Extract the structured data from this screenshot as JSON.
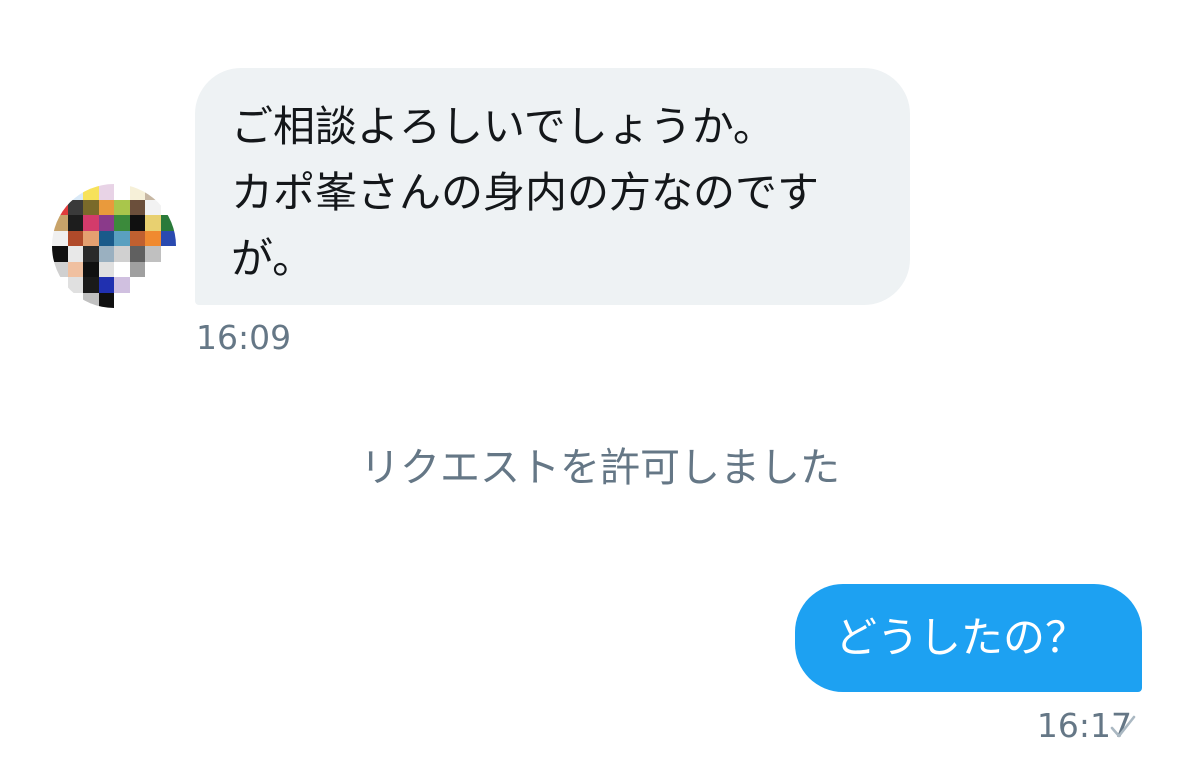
{
  "conversation": {
    "incoming": {
      "avatar_icon": "user-avatar-pixelated",
      "lines": [
        "ご相談よろしいでしょうか。",
        "カポ峯さんの身内の方なのです",
        "が。"
      ],
      "time": "16:09",
      "bubble_color": "#eef2f4"
    },
    "notice": "リクエストを許可しました",
    "outgoing": {
      "text": "どうしたの？",
      "time": "16:17",
      "status_icon": "check-icon",
      "bubble_color": "#1da1f2"
    }
  },
  "colors": {
    "text_primary": "#14171a",
    "text_secondary": "#657786",
    "accent": "#1da1f2"
  }
}
